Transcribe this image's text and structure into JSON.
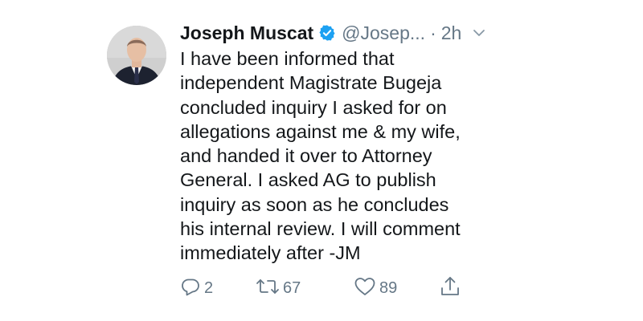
{
  "tweet": {
    "author_name": "Joseph Muscat",
    "handle": "@Josep...",
    "separator": "·",
    "time": "2h",
    "body_lines": [
      "I have been informed that",
      "independent Magistrate Bugeja",
      "concluded inquiry I asked for on",
      "allegations against me & my wife,",
      "and handed it over to Attorney",
      "General. I asked AG to publish",
      "inquiry as soon as he concludes",
      "his internal review. I will comment",
      "immediately after -JM"
    ],
    "verified": true
  },
  "actions": {
    "reply_count": "2",
    "retweet_count": "67",
    "like_count": "89"
  },
  "icons": {
    "verified": "verified-badge-icon",
    "caret": "chevron-down-icon",
    "reply": "reply-icon",
    "retweet": "retweet-icon",
    "like": "heart-icon",
    "share": "share-icon"
  },
  "colors": {
    "text": "#14171a",
    "secondary": "#657786",
    "verified_blue": "#1da1f2"
  }
}
